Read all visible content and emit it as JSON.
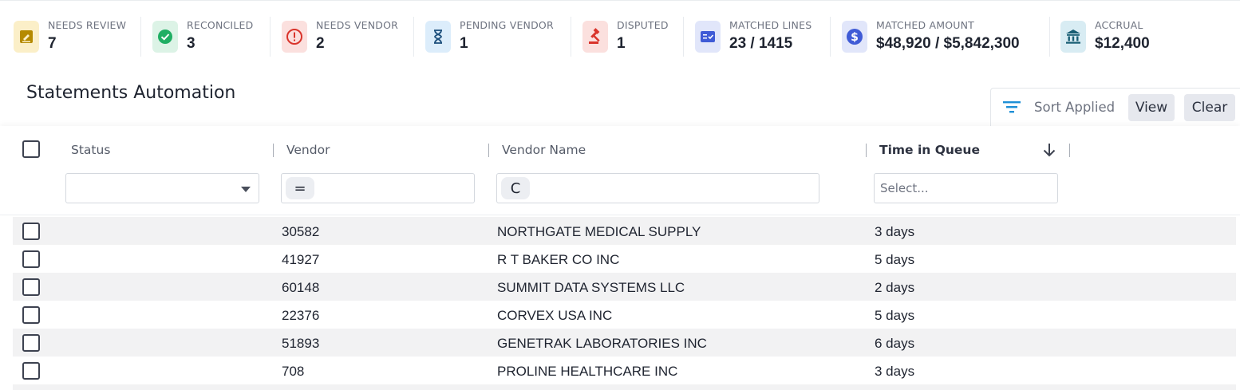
{
  "kpis": [
    {
      "label": "NEEDS REVIEW",
      "value": "7",
      "icon": "pencil-square-icon",
      "icon_bg": "#fbefc8",
      "icon_color": "#b58a00"
    },
    {
      "label": "RECONCILED",
      "value": "3",
      "icon": "check-circle-icon",
      "icon_bg": "#dcf3e6",
      "icon_color": "#1fae63"
    },
    {
      "label": "NEEDS VENDOR",
      "value": "2",
      "icon": "alert-circle-icon",
      "icon_bg": "#fbe0de",
      "icon_color": "#d9342b"
    },
    {
      "label": "PENDING VENDOR",
      "value": "1",
      "icon": "hourglass-icon",
      "icon_bg": "#dcedfb",
      "icon_color": "#1c4f7c"
    },
    {
      "label": "DISPUTED",
      "value": "1",
      "icon": "gavel-icon",
      "icon_bg": "#fbe0de",
      "icon_color": "#d9342b"
    },
    {
      "label": "MATCHED LINES",
      "value": "23 / 1415",
      "icon": "checklist-icon",
      "icon_bg": "#e1e6fa",
      "icon_color": "#3f5bd6"
    },
    {
      "label": "MATCHED AMOUNT",
      "value": "$48,920 / $5,842,300",
      "icon": "dollar-circle-icon",
      "icon_bg": "#e1e6fa",
      "icon_color": "#3f5bd6"
    },
    {
      "label": "ACCRUAL",
      "value": "$12,400",
      "icon": "bank-icon",
      "icon_bg": "#d8ecf3",
      "icon_color": "#175d73"
    }
  ],
  "page": {
    "title": "Statements Automation"
  },
  "sort_bar": {
    "label": "Sort Applied",
    "view_label": "View",
    "clear_label": "Clear",
    "accent": "#1e8fd6"
  },
  "table": {
    "columns": [
      {
        "label": "Status"
      },
      {
        "label": "Vendor"
      },
      {
        "label": "Vendor Name"
      },
      {
        "label": "Time in Queue",
        "sorted": "descending"
      }
    ],
    "filters": {
      "status": "",
      "vendor_operator": "=",
      "vendor_name_operator": "C",
      "time_in_queue_placeholder": "Select..."
    },
    "rows": [
      {
        "status": "",
        "vendor": "30582",
        "vendor_name": "NORTHGATE MEDICAL SUPPLY",
        "time_in_queue": "3 days"
      },
      {
        "status": "",
        "vendor": "41927",
        "vendor_name": "R T BAKER CO INC",
        "time_in_queue": "5 days"
      },
      {
        "status": "",
        "vendor": "60148",
        "vendor_name": "SUMMIT DATA SYSTEMS LLC",
        "time_in_queue": "2 days"
      },
      {
        "status": "",
        "vendor": "22376",
        "vendor_name": "CORVEX USA INC",
        "time_in_queue": "5 days"
      },
      {
        "status": "",
        "vendor": "51893",
        "vendor_name": "GENETRAK LABORATORIES INC",
        "time_in_queue": "6 days"
      },
      {
        "status": "",
        "vendor": "708",
        "vendor_name": "PROLINE HEALTHCARE INC",
        "time_in_queue": "3 days"
      }
    ]
  }
}
